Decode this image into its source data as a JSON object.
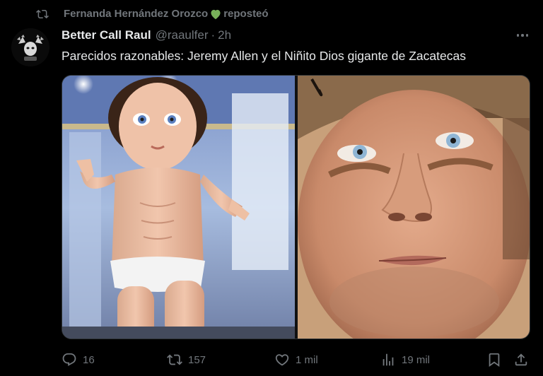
{
  "repost": {
    "user": "Fernanda Hernández Orozco",
    "label": "reposteó",
    "emoji": "green-heart-icon"
  },
  "tweet": {
    "display_name": "Better Call Raul",
    "handle": "@raaulfer",
    "separator": "·",
    "time": "2h",
    "text": "Parecidos razonables: Jeremy Allen y el Niñito Dios gigante de Zacatecas"
  },
  "media": {
    "left_image": "giant-baby-jesus-statue-photo",
    "right_image": "man-face-closeup-photo"
  },
  "actions": {
    "replies": "16",
    "reposts": "157",
    "likes": "1 mil",
    "views": "19 mil"
  },
  "colors": {
    "background": "#000000",
    "text_primary": "#e7e9ea",
    "text_secondary": "#71767b",
    "heart": "#78b159"
  }
}
